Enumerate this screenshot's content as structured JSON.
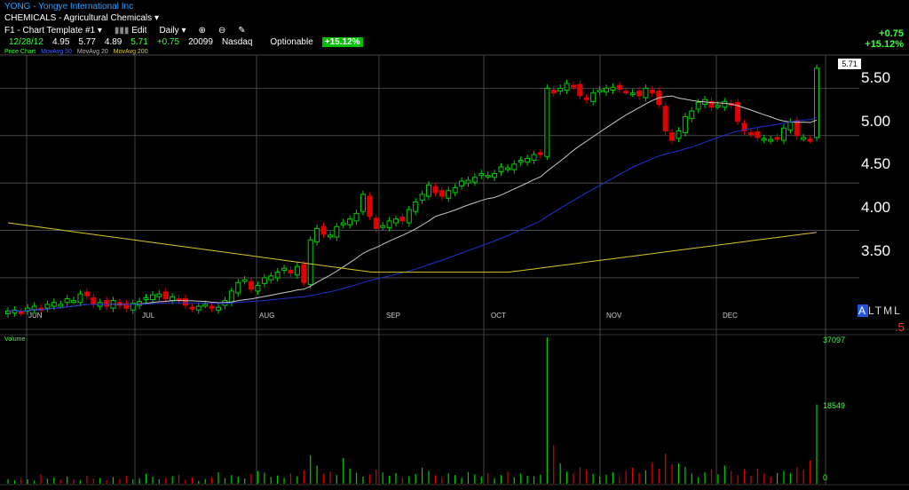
{
  "header": {
    "symbol_line": "YONG - Yongye International Inc",
    "industry_line": "CHEMICALS - Agricultural Chemicals",
    "template_label": "F1 - Chart Template #1",
    "edit_label": "Edit",
    "period_label": "Daily",
    "quote": {
      "date": "12/28/12",
      "open": "4.95",
      "high": "5.77",
      "low": "4.89",
      "close": "5.71",
      "change": "+0.75",
      "volume": "20099",
      "exchange": "Nasdaq",
      "optionable": "Optionable",
      "change_pct": "+15.12%"
    },
    "right_change": "+0.75",
    "right_change_pct": "+15.12%"
  },
  "legend": {
    "price_chart": "Price Chart",
    "ma50": "MovAvg 50",
    "ma20": "MovAvg 20",
    "ma200": "MovAvg 200"
  },
  "price_axis": [
    "5.50",
    "5.00",
    "4.50",
    "4.00",
    "3.50"
  ],
  "current_price_tag": "5.71",
  "months": [
    "JUN",
    "JUL",
    "AUG",
    "SEP",
    "OCT",
    "NOV",
    "DEC"
  ],
  "volume_panel": {
    "label": "Volume",
    "axis": [
      "37097",
      "18549",
      "0"
    ]
  },
  "right_tag": "ALTML",
  "right_digit": ".5",
  "colors": {
    "up": "#00d000",
    "down": "#e00000",
    "ma20": "#c8c8c8",
    "ma50": "#2030d0",
    "ma200": "#d8c820",
    "grid": "#555555"
  },
  "chart_data": {
    "type": "candlestick",
    "price_ylim": [
      3.2,
      5.85
    ],
    "volume_ylim": [
      0,
      37097
    ],
    "closes": [
      3.15,
      3.16,
      3.13,
      3.18,
      3.2,
      3.16,
      3.22,
      3.24,
      3.22,
      3.28,
      3.26,
      3.33,
      3.31,
      3.22,
      3.24,
      3.2,
      3.26,
      3.21,
      3.18,
      3.23,
      3.25,
      3.29,
      3.32,
      3.33,
      3.28,
      3.3,
      3.26,
      3.21,
      3.18,
      3.2,
      3.22,
      3.18,
      3.19,
      3.26,
      3.36,
      3.45,
      3.48,
      3.38,
      3.42,
      3.5,
      3.52,
      3.56,
      3.6,
      3.55,
      3.62,
      3.45,
      3.9,
      4.02,
      3.96,
      3.95,
      4.04,
      4.08,
      4.12,
      4.18,
      4.38,
      4.15,
      4.02,
      4.05,
      4.1,
      4.12,
      4.1,
      4.22,
      4.3,
      4.38,
      4.48,
      4.4,
      4.36,
      4.42,
      4.45,
      4.52,
      4.53,
      4.56,
      4.6,
      4.58,
      4.6,
      4.67,
      4.66,
      4.7,
      4.74,
      4.76,
      4.8,
      4.8,
      5.5,
      5.45,
      5.5,
      5.55,
      5.52,
      5.42,
      5.38,
      5.45,
      5.48,
      5.5,
      5.51,
      5.49,
      5.47,
      5.45,
      5.42,
      5.5,
      5.45,
      5.33,
      5.05,
      4.95,
      5.05,
      5.2,
      5.26,
      5.35,
      5.38,
      5.3,
      5.32,
      5.36,
      5.33,
      5.15,
      5.05,
      5.02,
      4.98,
      4.97,
      4.96,
      4.97,
      5.08,
      5.14,
      5.0,
      4.98,
      4.96,
      5.71
    ],
    "volumes": [
      1200,
      900,
      1500,
      1100,
      800,
      2400,
      1300,
      1600,
      1000,
      1800,
      1200,
      900,
      2100,
      1300,
      1500,
      900,
      1700,
      1200,
      2000,
      1100,
      1400,
      2600,
      1800,
      1100,
      1500,
      1900,
      2300,
      1000,
      1700,
      800,
      1200,
      1600,
      2900,
      1400,
      2200,
      1800,
      1300,
      2500,
      3200,
      2800,
      1700,
      2100,
      1500,
      2600,
      1900,
      3400,
      7200,
      4600,
      2500,
      3100,
      2200,
      6500,
      3900,
      2800,
      1800,
      2400,
      3600,
      2900,
      2000,
      2700,
      1600,
      1900,
      2500,
      4100,
      3300,
      2200,
      1700,
      2600,
      2200,
      1500,
      3000,
      2400,
      1800,
      2700,
      1400,
      2200,
      3100,
      1700,
      2600,
      2000,
      1900,
      2300,
      37097,
      9800,
      5200,
      3100,
      2700,
      4200,
      3600,
      2500,
      1800,
      2300,
      2900,
      1700,
      3300,
      4100,
      2700,
      3400,
      5400,
      3800,
      7600,
      4900,
      5200,
      4300,
      2600,
      1700,
      2900,
      3700,
      2400,
      4600,
      3200,
      2200,
      3600,
      2100,
      3900,
      2500,
      1800,
      2700,
      3300,
      2600,
      4200,
      3500,
      5900,
      20099
    ]
  }
}
